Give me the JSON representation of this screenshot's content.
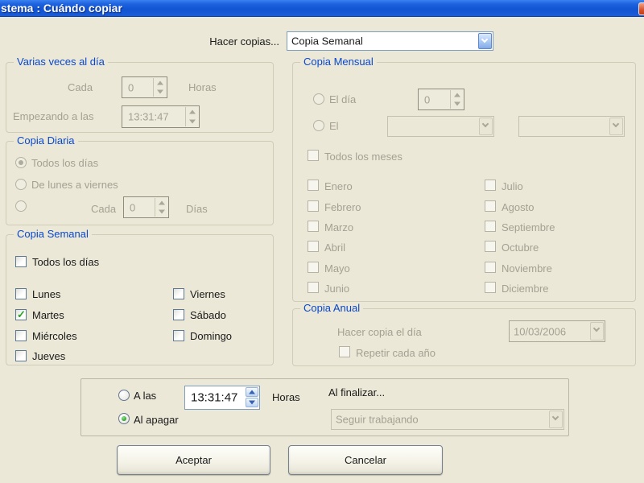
{
  "window": {
    "title": "stema : Cuándo copiar"
  },
  "colors": {
    "titlebar_blue": "#1254D2",
    "group_title_blue": "#0847CE",
    "check_green": "#2AA22A",
    "close_red": "#C23C17",
    "dialog_bg": "#EBE8D8",
    "disabled_text": "#A5A192"
  },
  "top": {
    "label": "Hacer copias...",
    "dropdown_value": "Copia Semanal"
  },
  "groups": {
    "varias": {
      "title": "Varias veces al día",
      "cada_label": "Cada",
      "cada_value": "0",
      "horas_label": "Horas",
      "empezando_label": "Empezando a las",
      "empezando_value": "13:31:47"
    },
    "diaria": {
      "title": "Copia Diaria",
      "options": [
        {
          "label": "Todos los días",
          "selected": true
        },
        {
          "label": "De lunes a viernes",
          "selected": false
        },
        {
          "label": "",
          "selected": false
        }
      ],
      "cada_label": "Cada",
      "cada_value": "0",
      "dias_label": "Días"
    },
    "semanal": {
      "title": "Copia Semanal",
      "todos_dias": {
        "label": "Todos los días",
        "checked": false
      },
      "days_left": [
        {
          "label": "Lunes",
          "checked": false
        },
        {
          "label": "Martes",
          "checked": true
        },
        {
          "label": "Miércoles",
          "checked": false
        },
        {
          "label": "Jueves",
          "checked": false
        }
      ],
      "days_right": [
        {
          "label": "Viernes",
          "checked": false
        },
        {
          "label": "Sábado",
          "checked": false
        },
        {
          "label": "Domingo",
          "checked": false
        }
      ]
    },
    "mensual": {
      "title": "Copia Mensual",
      "el_dia": {
        "label": "El día",
        "value": "0",
        "selected": false
      },
      "el": {
        "label": "El",
        "value1": "",
        "value2": "",
        "selected": false
      },
      "todos_meses": {
        "label": "Todos los meses",
        "checked": false
      },
      "months_left": [
        "Enero",
        "Febrero",
        "Marzo",
        "Abril",
        "Mayo",
        "Junio"
      ],
      "months_right": [
        "Julio",
        "Agosto",
        "Septiembre",
        "Octubre",
        "Noviembre",
        "Diciembre"
      ]
    },
    "anual": {
      "title": "Copia Anual",
      "hacer_label": "Hacer copia el día",
      "date_value": "10/03/2006",
      "repetir": {
        "label": "Repetir cada año",
        "checked": false
      }
    }
  },
  "bottom": {
    "a_las": {
      "label": "A las",
      "selected": false
    },
    "time_value": "13:31:47",
    "horas_label": "Horas",
    "al_apagar": {
      "label": "Al apagar",
      "selected": true
    },
    "al_finalizar_label": "Al finalizar...",
    "finalizar_value": "Seguir trabajando"
  },
  "buttons": {
    "accept": "Aceptar",
    "cancel": "Cancelar"
  }
}
